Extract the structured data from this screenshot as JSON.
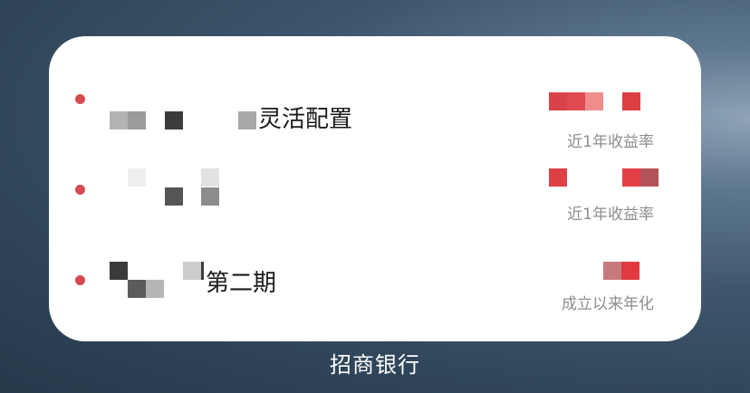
{
  "widget": {
    "items": [
      {
        "name_suffix": "灵活配置",
        "metric_label": "近1年收益率"
      },
      {
        "name_suffix": "",
        "metric_label": "近1年收益率"
      },
      {
        "name_suffix": "第二期",
        "metric_label": "成立以来年化"
      }
    ]
  },
  "app": {
    "label": "招商银行"
  },
  "colors": {
    "accent": "#d64a52",
    "metric_red": "#e04a52"
  }
}
